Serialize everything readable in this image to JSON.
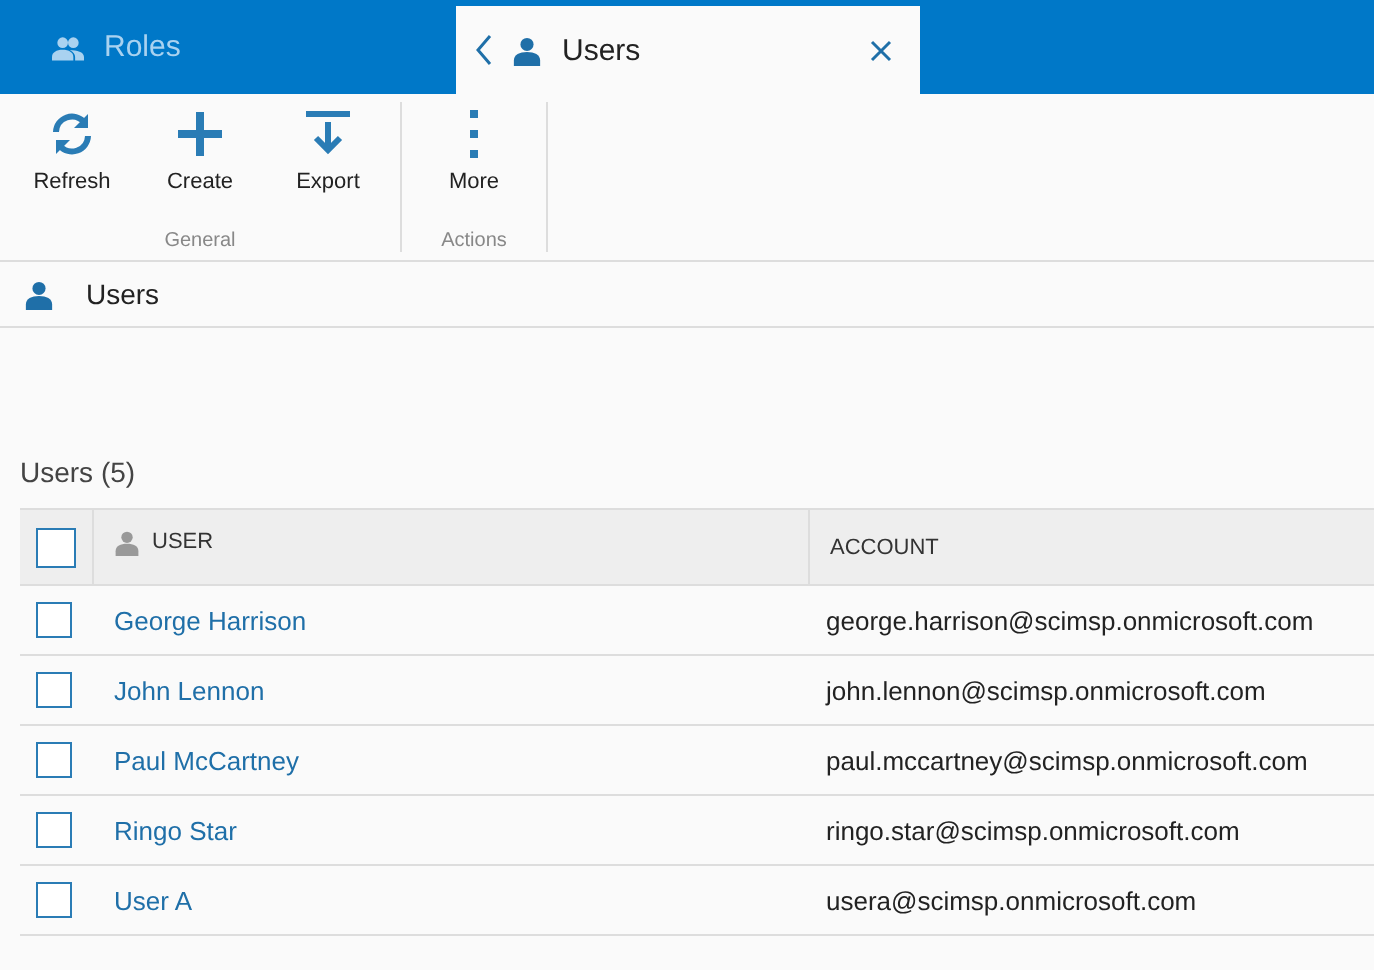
{
  "tabs": [
    {
      "label": "Roles",
      "kind": "group",
      "selected": false
    },
    {
      "label": "Users",
      "kind": "single",
      "selected": true
    }
  ],
  "toolbar": {
    "groups": [
      {
        "label": "General",
        "buttons": [
          {
            "label": "Refresh",
            "kind": "refresh"
          },
          {
            "label": "Create",
            "kind": "create"
          },
          {
            "label": "Export",
            "kind": "export"
          }
        ]
      },
      {
        "label": "Actions",
        "buttons": [
          {
            "label": "More",
            "kind": "more"
          }
        ]
      }
    ]
  },
  "breadcrumb": {
    "label": "Users"
  },
  "section_title": "Users (5)",
  "table": {
    "select_all_checked": false,
    "columns": [
      "USER",
      "ACCOUNT"
    ],
    "rows": [
      {
        "user": "George Harrison",
        "account": "george.harrison@scimsp.onmicrosoft.com",
        "checked": false
      },
      {
        "user": "John Lennon",
        "account": "john.lennon@scimsp.onmicrosoft.com",
        "checked": false
      },
      {
        "user": "Paul McCartney",
        "account": "paul.mccartney@scimsp.onmicrosoft.com",
        "checked": false
      },
      {
        "user": "Ringo Star",
        "account": "ringo.star@scimsp.onmicrosoft.com",
        "checked": false
      },
      {
        "user": "User A",
        "account": "usera@scimsp.onmicrosoft.com",
        "checked": false
      }
    ]
  }
}
